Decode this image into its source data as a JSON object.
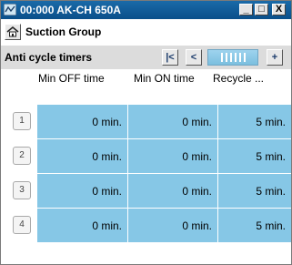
{
  "window": {
    "title": "00:000 AK-CH 650A",
    "minimize_glyph": "_",
    "maximize_glyph": "□",
    "close_glyph": "X"
  },
  "header": {
    "group_label": "Suction Group",
    "home_icon": "home-icon"
  },
  "toolbar": {
    "anti_cycle_label": "Anti cycle timers",
    "first_glyph": "|<",
    "prev_glyph": "<",
    "next_glyph": "+"
  },
  "table": {
    "columns": [
      "Min OFF time",
      "Min ON time",
      "Recycle ..."
    ],
    "rows": [
      {
        "index": "1",
        "values": [
          "0 min.",
          "0 min.",
          "5 min."
        ]
      },
      {
        "index": "2",
        "values": [
          "0 min.",
          "0 min.",
          "5 min."
        ]
      },
      {
        "index": "3",
        "values": [
          "0 min.",
          "0 min.",
          "5 min."
        ]
      },
      {
        "index": "4",
        "values": [
          "0 min.",
          "0 min.",
          "5 min."
        ]
      }
    ]
  },
  "colors": {
    "titlebar": "#0a4f8a",
    "cell_bg": "#86c7e6",
    "toolbar_bg": "#dcdcdc"
  }
}
